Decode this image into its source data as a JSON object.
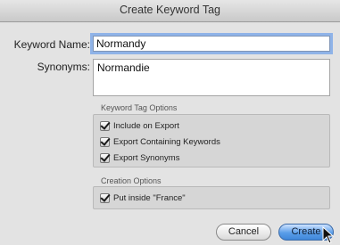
{
  "window": {
    "title": "Create Keyword Tag"
  },
  "form": {
    "keyword_name_label": "Keyword Name:",
    "keyword_name_value": "Normandy",
    "synonyms_label": "Synonyms:",
    "synonyms_value": "Normandie"
  },
  "keyword_tag_options": {
    "heading": "Keyword Tag Options",
    "items": [
      {
        "label": "Include on Export",
        "checked": true
      },
      {
        "label": "Export Containing Keywords",
        "checked": true
      },
      {
        "label": "Export Synonyms",
        "checked": true
      }
    ]
  },
  "creation_options": {
    "heading": "Creation Options",
    "items": [
      {
        "label": "Put inside \"France\"",
        "checked": true
      }
    ]
  },
  "buttons": {
    "cancel": "Cancel",
    "create": "Create"
  },
  "colors": {
    "focus_ring": "#8fb3e8",
    "default_button": "#5a9de8"
  }
}
